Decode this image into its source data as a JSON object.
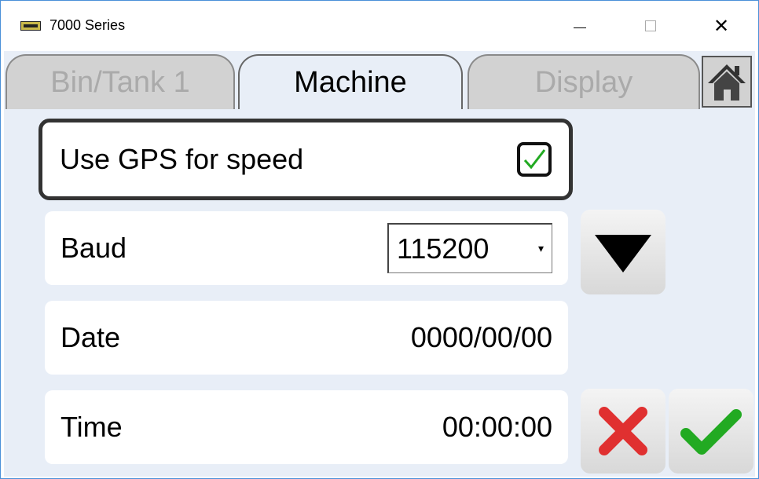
{
  "window": {
    "title": "7000 Series",
    "icon": "app-icon",
    "controls": {
      "minimize": "minimize-icon",
      "maximize": "maximize-icon",
      "close": "close-icon"
    }
  },
  "tabs": [
    {
      "label": "Bin/Tank 1",
      "active": false
    },
    {
      "label": "Machine",
      "active": true
    },
    {
      "label": "Display",
      "active": false
    }
  ],
  "home_icon": "home-icon",
  "settings": {
    "gps": {
      "label": "Use GPS for speed",
      "checked": true
    },
    "baud": {
      "label": "Baud",
      "value": "115200"
    },
    "date": {
      "label": "Date",
      "value": "0000/00/00"
    },
    "time": {
      "label": "Time",
      "value": "00:00:00"
    }
  },
  "buttons": {
    "down": "down-arrow-icon",
    "cancel": "cancel-icon",
    "confirm": "confirm-icon"
  },
  "colors": {
    "background": "#e8eef7",
    "tab_inactive": "#d2d2d2",
    "check_green": "#22aa22",
    "cancel_red": "#e03030"
  }
}
